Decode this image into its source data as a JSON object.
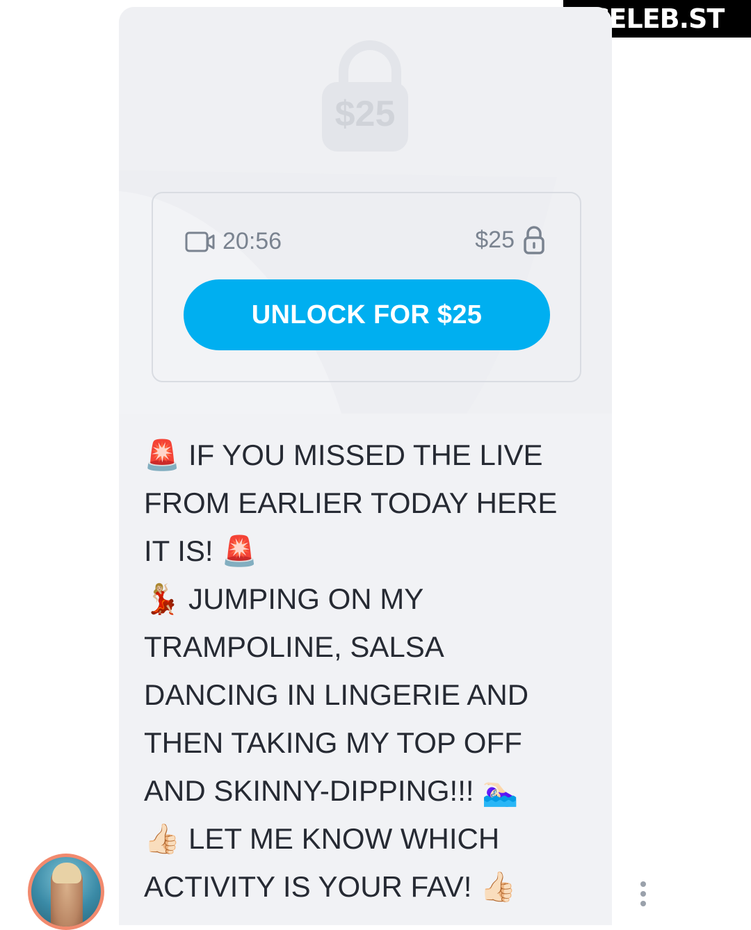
{
  "watermark": "CELEB.ST",
  "locked_post": {
    "preview_price": "$25",
    "duration": "20:56",
    "price": "$25",
    "unlock_button": "UNLOCK FOR $25"
  },
  "caption": {
    "lines": [
      "🚨 IF YOU MISSED THE LIVE",
      "FROM EARLIER TODAY HERE",
      "IT IS! 🚨",
      "💃🏼 JUMPING ON MY",
      "TRAMPOLINE, SALSA",
      "DANCING IN LINGERIE AND",
      "THEN TAKING MY TOP OFF",
      "AND SKINNY-DIPPING!!! 🏊🏻‍♀️",
      "👍🏻 LET ME KNOW WHICH",
      "ACTIVITY IS YOUR FAV! 👍🏻"
    ]
  },
  "colors": {
    "accent": "#00aff0",
    "avatar_ring": "#f28a6e",
    "card_background": "#f1f2f5"
  },
  "icons": [
    "video-icon",
    "lock-icon",
    "big-lock-icon",
    "more-vertical-icon"
  ]
}
